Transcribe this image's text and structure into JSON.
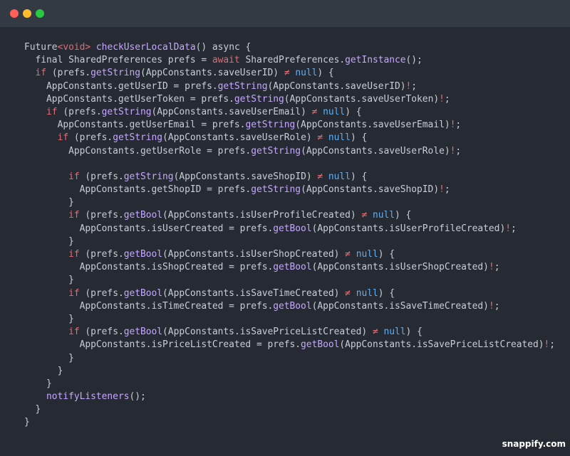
{
  "window": {
    "controls": [
      "close",
      "minimize",
      "maximize"
    ],
    "colors": {
      "close": "#ff5f57",
      "minimize": "#febc2e",
      "maximize": "#28c840"
    }
  },
  "code": {
    "lines": [
      [
        [
          "plain",
          "Future"
        ],
        [
          "kw",
          "<void>"
        ],
        [
          "plain",
          " "
        ],
        [
          "fn",
          "checkUserLocalData"
        ],
        [
          "plain",
          "() async {"
        ]
      ],
      [
        [
          "plain",
          "  final SharedPreferences prefs = "
        ],
        [
          "kw",
          "await"
        ],
        [
          "plain",
          " SharedPreferences."
        ],
        [
          "fn",
          "getInstance"
        ],
        [
          "plain",
          "();"
        ]
      ],
      [
        [
          "plain",
          "  "
        ],
        [
          "kw",
          "if"
        ],
        [
          "plain",
          " (prefs."
        ],
        [
          "fn",
          "getString"
        ],
        [
          "plain",
          "(AppConstants.saveUserID) "
        ],
        [
          "op",
          "≠"
        ],
        [
          "plain",
          " "
        ],
        [
          "null",
          "null"
        ],
        [
          "plain",
          ") {"
        ]
      ],
      [
        [
          "plain",
          "    AppConstants.getUserID = prefs."
        ],
        [
          "fn",
          "getString"
        ],
        [
          "plain",
          "(AppConstants.saveUserID)"
        ],
        [
          "op",
          "!"
        ],
        [
          "plain",
          ";"
        ]
      ],
      [
        [
          "plain",
          "    AppConstants.getUserToken = prefs."
        ],
        [
          "fn",
          "getString"
        ],
        [
          "plain",
          "(AppConstants.saveUserToken)"
        ],
        [
          "op",
          "!"
        ],
        [
          "plain",
          ";"
        ]
      ],
      [
        [
          "plain",
          "    "
        ],
        [
          "kw",
          "if"
        ],
        [
          "plain",
          " (prefs."
        ],
        [
          "fn",
          "getString"
        ],
        [
          "plain",
          "(AppConstants.saveUserEmail) "
        ],
        [
          "op",
          "≠"
        ],
        [
          "plain",
          " "
        ],
        [
          "null",
          "null"
        ],
        [
          "plain",
          ") {"
        ]
      ],
      [
        [
          "plain",
          "      AppConstants.getUserEmail = prefs."
        ],
        [
          "fn",
          "getString"
        ],
        [
          "plain",
          "(AppConstants.saveUserEmail)"
        ],
        [
          "op",
          "!"
        ],
        [
          "plain",
          ";"
        ]
      ],
      [
        [
          "plain",
          "      "
        ],
        [
          "kw",
          "if"
        ],
        [
          "plain",
          " (prefs."
        ],
        [
          "fn",
          "getString"
        ],
        [
          "plain",
          "(AppConstants.saveUserRole) "
        ],
        [
          "op",
          "≠"
        ],
        [
          "plain",
          " "
        ],
        [
          "null",
          "null"
        ],
        [
          "plain",
          ") {"
        ]
      ],
      [
        [
          "plain",
          "        AppConstants.getUserRole = prefs."
        ],
        [
          "fn",
          "getString"
        ],
        [
          "plain",
          "(AppConstants.saveUserRole)"
        ],
        [
          "op",
          "!"
        ],
        [
          "plain",
          ";"
        ]
      ],
      [
        [
          "plain",
          ""
        ]
      ],
      [
        [
          "plain",
          "        "
        ],
        [
          "kw",
          "if"
        ],
        [
          "plain",
          " (prefs."
        ],
        [
          "fn",
          "getString"
        ],
        [
          "plain",
          "(AppConstants.saveShopID) "
        ],
        [
          "op",
          "≠"
        ],
        [
          "plain",
          " "
        ],
        [
          "null",
          "null"
        ],
        [
          "plain",
          ") {"
        ]
      ],
      [
        [
          "plain",
          "          AppConstants.getShopID = prefs."
        ],
        [
          "fn",
          "getString"
        ],
        [
          "plain",
          "(AppConstants.saveShopID)"
        ],
        [
          "op",
          "!"
        ],
        [
          "plain",
          ";"
        ]
      ],
      [
        [
          "plain",
          "        }"
        ]
      ],
      [
        [
          "plain",
          "        "
        ],
        [
          "kw",
          "if"
        ],
        [
          "plain",
          " (prefs."
        ],
        [
          "fn",
          "getBool"
        ],
        [
          "plain",
          "(AppConstants.isUserProfileCreated) "
        ],
        [
          "op",
          "≠"
        ],
        [
          "plain",
          " "
        ],
        [
          "null",
          "null"
        ],
        [
          "plain",
          ") {"
        ]
      ],
      [
        [
          "plain",
          "          AppConstants.isUserCreated = prefs."
        ],
        [
          "fn",
          "getBool"
        ],
        [
          "plain",
          "(AppConstants.isUserProfileCreated)"
        ],
        [
          "op",
          "!"
        ],
        [
          "plain",
          ";"
        ]
      ],
      [
        [
          "plain",
          "        }"
        ]
      ],
      [
        [
          "plain",
          "        "
        ],
        [
          "kw",
          "if"
        ],
        [
          "plain",
          " (prefs."
        ],
        [
          "fn",
          "getBool"
        ],
        [
          "plain",
          "(AppConstants.isUserShopCreated) "
        ],
        [
          "op",
          "≠"
        ],
        [
          "plain",
          " "
        ],
        [
          "null",
          "null"
        ],
        [
          "plain",
          ") {"
        ]
      ],
      [
        [
          "plain",
          "          AppConstants.isShopCreated = prefs."
        ],
        [
          "fn",
          "getBool"
        ],
        [
          "plain",
          "(AppConstants.isUserShopCreated)"
        ],
        [
          "op",
          "!"
        ],
        [
          "plain",
          ";"
        ]
      ],
      [
        [
          "plain",
          "        }"
        ]
      ],
      [
        [
          "plain",
          "        "
        ],
        [
          "kw",
          "if"
        ],
        [
          "plain",
          " (prefs."
        ],
        [
          "fn",
          "getBool"
        ],
        [
          "plain",
          "(AppConstants.isSaveTimeCreated) "
        ],
        [
          "op",
          "≠"
        ],
        [
          "plain",
          " "
        ],
        [
          "null",
          "null"
        ],
        [
          "plain",
          ") {"
        ]
      ],
      [
        [
          "plain",
          "          AppConstants.isTimeCreated = prefs."
        ],
        [
          "fn",
          "getBool"
        ],
        [
          "plain",
          "(AppConstants.isSaveTimeCreated)"
        ],
        [
          "op",
          "!"
        ],
        [
          "plain",
          ";"
        ]
      ],
      [
        [
          "plain",
          "        }"
        ]
      ],
      [
        [
          "plain",
          "        "
        ],
        [
          "kw",
          "if"
        ],
        [
          "plain",
          " (prefs."
        ],
        [
          "fn",
          "getBool"
        ],
        [
          "plain",
          "(AppConstants.isSavePriceListCreated) "
        ],
        [
          "op",
          "≠"
        ],
        [
          "plain",
          " "
        ],
        [
          "null",
          "null"
        ],
        [
          "plain",
          ") {"
        ]
      ],
      [
        [
          "plain",
          "          AppConstants.isPriceListCreated = prefs."
        ],
        [
          "fn",
          "getBool"
        ],
        [
          "plain",
          "(AppConstants.isSavePriceListCreated)"
        ],
        [
          "op",
          "!"
        ],
        [
          "plain",
          ";"
        ]
      ],
      [
        [
          "plain",
          "        }"
        ]
      ],
      [
        [
          "plain",
          "      }"
        ]
      ],
      [
        [
          "plain",
          "    }"
        ]
      ],
      [
        [
          "plain",
          "    "
        ],
        [
          "fn",
          "notifyListeners"
        ],
        [
          "plain",
          "();"
        ]
      ],
      [
        [
          "plain",
          "  }"
        ]
      ],
      [
        [
          "plain",
          "}"
        ]
      ]
    ]
  },
  "watermark": "snappify.com"
}
